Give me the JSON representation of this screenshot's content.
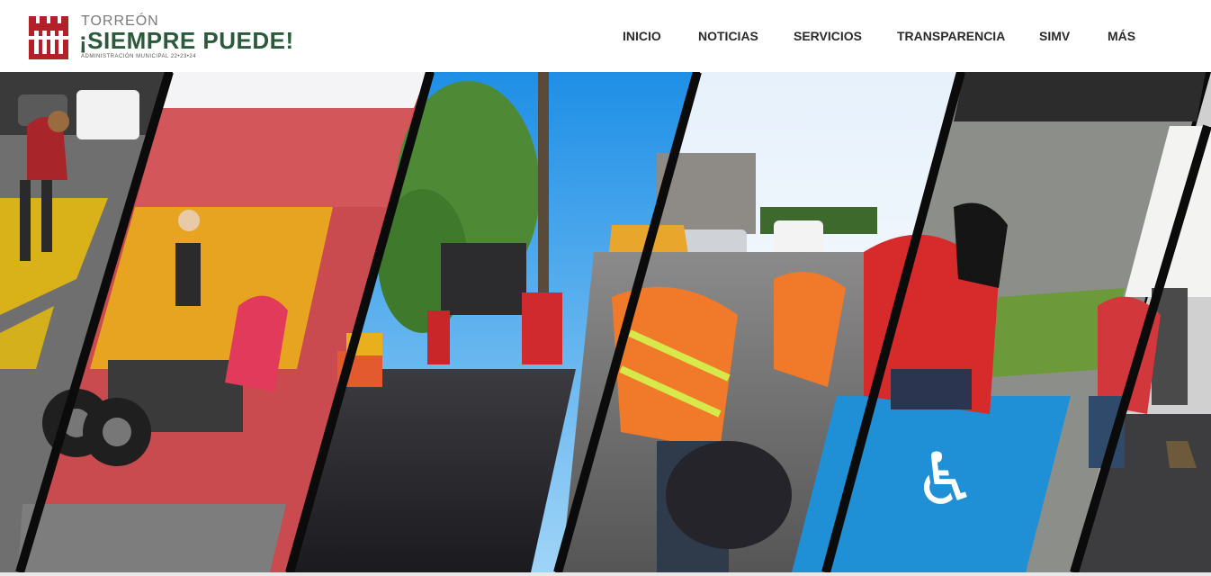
{
  "logo": {
    "city": "TORREÓN",
    "slogan": "¡SIEMPRE PUEDE!",
    "subtitle": "ADMINISTRACIÓN MUNICIPAL  22•23•24",
    "primary_color": "#b3202a",
    "secondary_color": "#2a5a3a"
  },
  "nav": {
    "items": [
      {
        "label": "INICIO"
      },
      {
        "label": "NOTICIAS"
      },
      {
        "label": "SERVICIOS"
      },
      {
        "label": "TRANSPARENCIA"
      },
      {
        "label": "SIMV"
      },
      {
        "label": "MÁS"
      }
    ]
  },
  "hero": {
    "panels": [
      {
        "subject": "worker in red hoodie painting yellow road markings"
      },
      {
        "subject": "yellow asphalt truck with worker"
      },
      {
        "subject": "crew paving street with fresh asphalt"
      },
      {
        "subject": "worker in orange safety vest filling pothole"
      },
      {
        "subject": "worker painting blue accessible parking symbol"
      },
      {
        "subject": "worker raking asphalt next to truck"
      }
    ]
  }
}
